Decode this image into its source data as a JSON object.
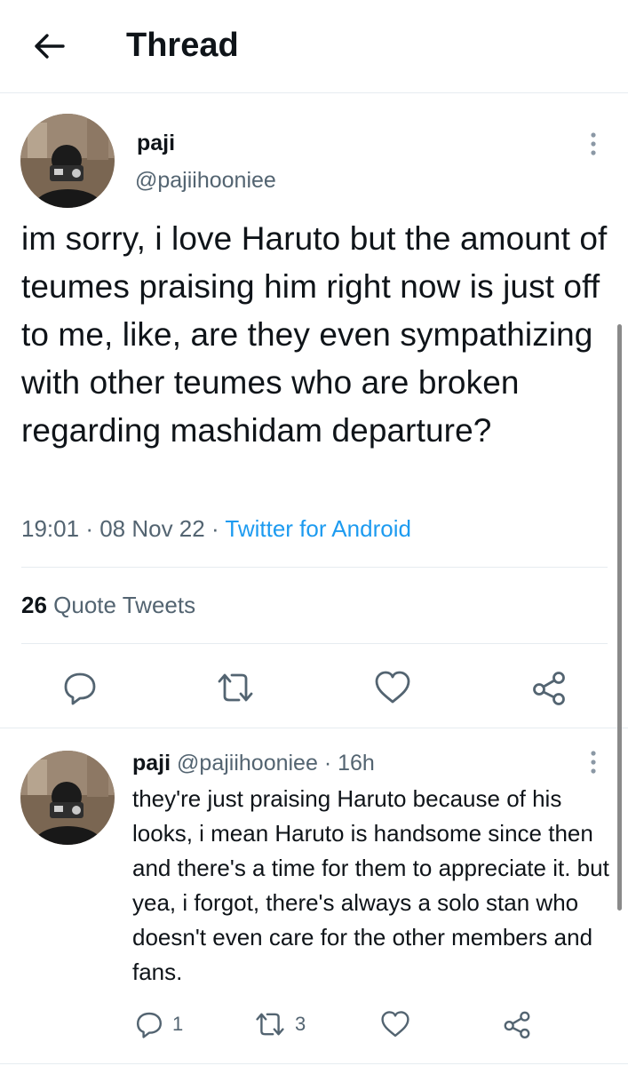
{
  "header": {
    "title": "Thread",
    "back_icon": "arrow-left-icon"
  },
  "tweet": {
    "name": "paji",
    "handle": "@pajiihooniee",
    "text": "im sorry, i love Haruto but the amount of teumes praising him right now is just off to me, like, are they even sympathizing with other teumes who are broken regarding mashidam departure?",
    "time": "19:01",
    "date": "08 Nov 22",
    "source": "Twitter for Android",
    "quote_count": "26",
    "quote_label": "Quote Tweets",
    "actions": [
      "reply-icon",
      "retweet-icon",
      "like-icon",
      "share-icon"
    ]
  },
  "reply": {
    "name": "paji",
    "handle": "@pajiihooniee",
    "age": "16h",
    "text": "they're just praising Haruto because of his looks, i mean Haruto is handsome since then and there's a time for them to appreciate it. but yea, i forgot, there's always a solo stan who doesn't even care for the other members and fans.",
    "reply_count": "1",
    "retweet_count": "3"
  },
  "colors": {
    "text": "#0f1419",
    "secondary": "#536471",
    "link": "#1d9bf0",
    "divider": "#e6ecf0"
  }
}
